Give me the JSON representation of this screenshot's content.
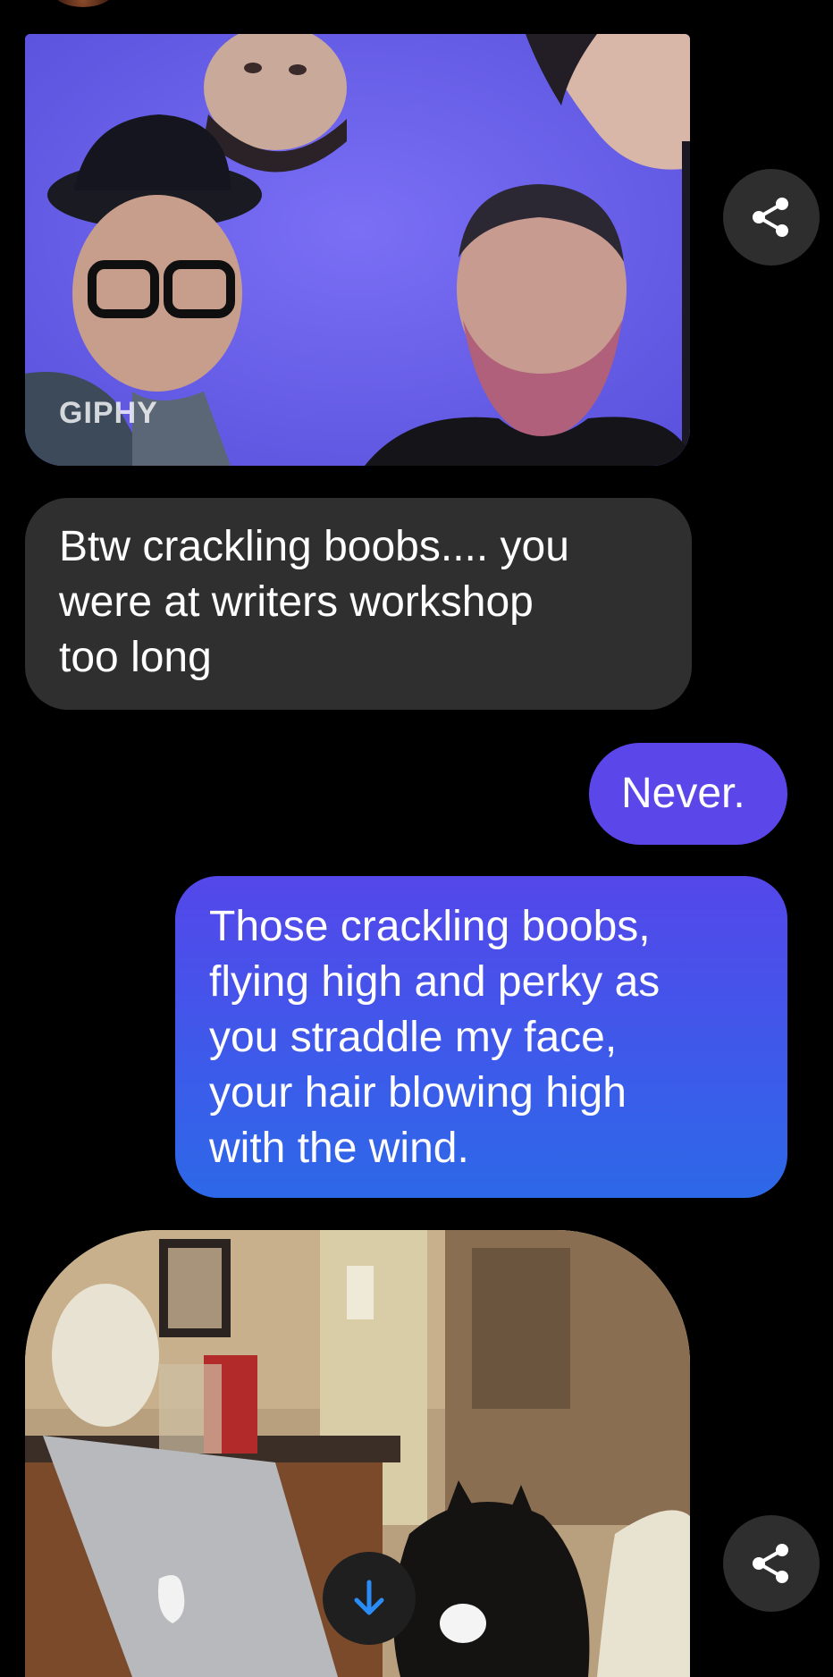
{
  "conversation": {
    "gif_1": {
      "watermark": "GIPHY"
    },
    "incoming_message": {
      "lines": [
        "Btw crackling boobs.... you",
        "were at writers workshop",
        "too long"
      ]
    },
    "outgoing_message_1": {
      "text": "Never."
    },
    "outgoing_message_2": {
      "lines": [
        "Those crackling boobs,",
        "flying high and perky as",
        "you straddle my face,",
        "your hair blowing high",
        "with the wind."
      ]
    }
  },
  "icons": {
    "share": "share-icon",
    "scroll_down": "arrow-down-icon"
  },
  "colors": {
    "background": "#000000",
    "incoming_bubble": "#2f2f2f",
    "outgoing_bubble": "#5b46ea",
    "outgoing_gradient_end": "#2d68e8",
    "accent_arrow": "#2a8cf5"
  }
}
